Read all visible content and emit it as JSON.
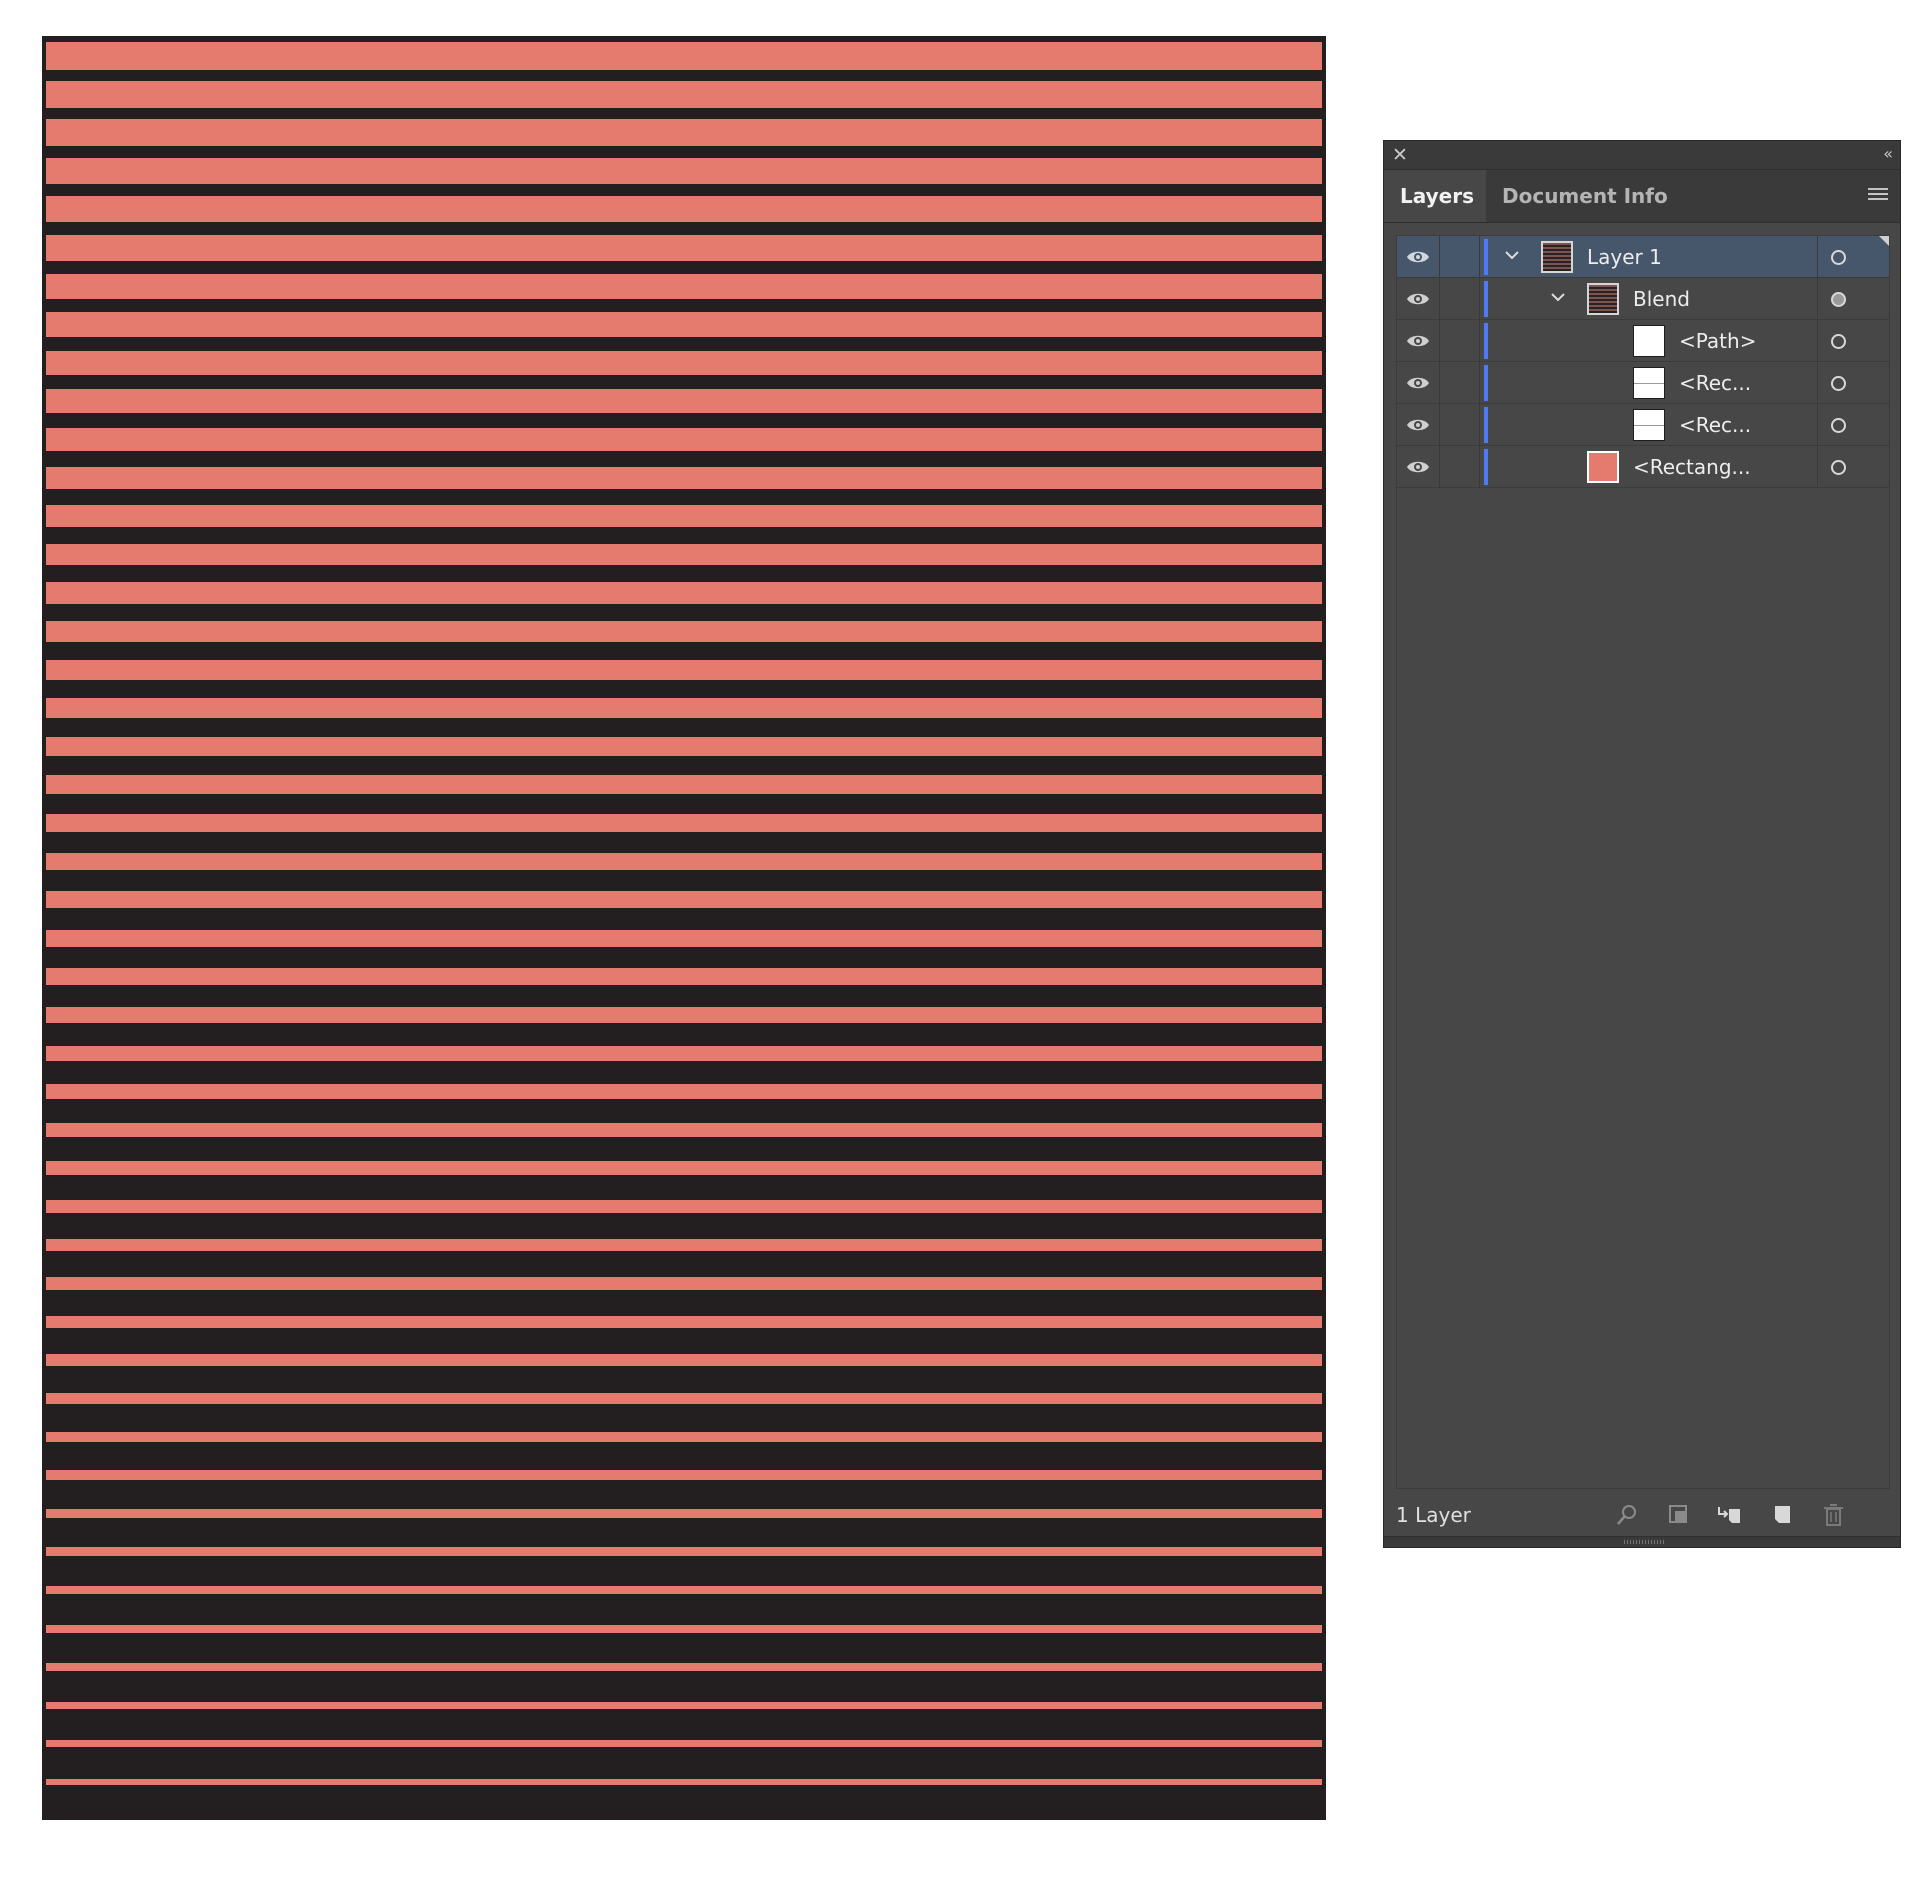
{
  "colors": {
    "artboard_bg": "#231f20",
    "stripe": "#e57b6f",
    "panel_bg": "#474747",
    "selected_row": "#46566b",
    "layer_color": "#4f7af2"
  },
  "panel": {
    "tabs": [
      {
        "label": "Layers",
        "active": true
      },
      {
        "label": "Document Info",
        "active": false
      }
    ],
    "rows": [
      {
        "name": "Layer 1",
        "thumb": "stripes",
        "expanded": true,
        "selected": true
      },
      {
        "name": "Blend",
        "thumb": "stripes",
        "expanded": true,
        "selected": false
      },
      {
        "name": "<Path>",
        "thumb": "white",
        "selected": false
      },
      {
        "name": "<Rec...",
        "thumb": "white-line",
        "selected": false
      },
      {
        "name": "<Rec...",
        "thumb": "white-line",
        "selected": false
      },
      {
        "name": "<Rectang...",
        "thumb": "salmon",
        "selected": false
      }
    ],
    "footer_text": "1 Layer",
    "footer_icons": [
      "locate-object-icon",
      "make-clipping-mask-icon",
      "new-sublayer-icon",
      "new-layer-icon",
      "delete-icon"
    ]
  }
}
